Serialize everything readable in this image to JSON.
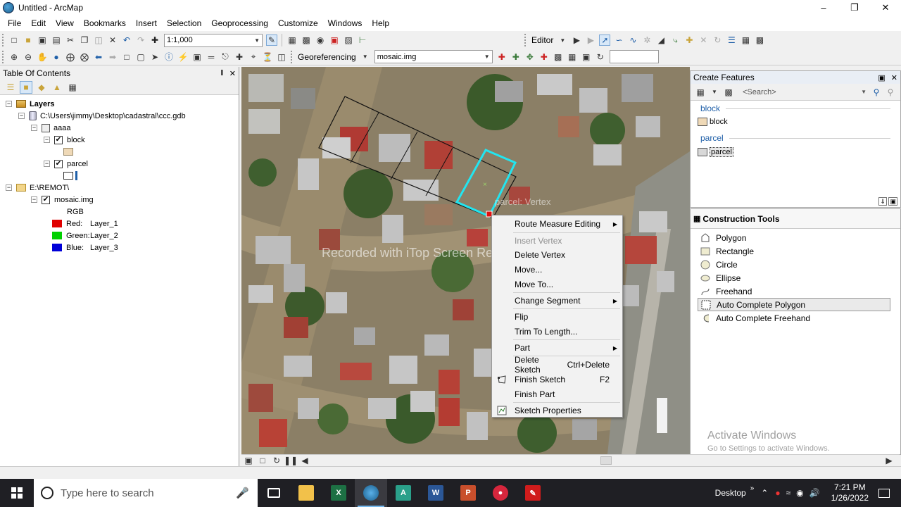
{
  "window": {
    "title": "Untitled - ArcMap",
    "minimize": "–",
    "restore": "❐",
    "close": "✕"
  },
  "menu": [
    "File",
    "Edit",
    "View",
    "Bookmarks",
    "Insert",
    "Selection",
    "Geoprocessing",
    "Customize",
    "Windows",
    "Help"
  ],
  "toolbar": {
    "scale": "1:1,000",
    "editor_label": "Editor",
    "georef_label": "Georeferencing",
    "georef_layer": "mosaic.img"
  },
  "toc": {
    "title": "Table Of Contents",
    "pin": "‖",
    "close": "✕",
    "layers_label": "Layers",
    "gdb_path": "C:\\Users\\jimmy\\Desktop\\cadastral\\ccc.gdb",
    "dataset": "aaaa",
    "block": "block",
    "parcel": "parcel",
    "folder": "E:\\REMOT\\",
    "raster": "mosaic.img",
    "rgb": "RGB",
    "bands": [
      {
        "label": "Red:",
        "layer": "Layer_1",
        "color": "#e00000"
      },
      {
        "label": "Green:",
        "layer": "Layer_2",
        "color": "#00d000"
      },
      {
        "label": "Blue:",
        "layer": "Layer_3",
        "color": "#0000d8"
      }
    ]
  },
  "map": {
    "vertex_tip": "parcel: Vertex",
    "watermark": "Recorded with iTop Screen Recorder",
    "activate_title": "Activate Windows",
    "activate_sub": "Go to Settings to activate Windows."
  },
  "create_features": {
    "title": "Create Features",
    "search_placeholder": "<Search>",
    "groups": [
      {
        "name": "block",
        "template": "block",
        "color": "#efd9b7"
      },
      {
        "name": "parcel",
        "template": "parcel",
        "color": "#d8d8d8"
      }
    ]
  },
  "construction_tools": {
    "title": "Construction Tools",
    "tools": [
      "Polygon",
      "Rectangle",
      "Circle",
      "Ellipse",
      "Freehand",
      "Auto Complete Polygon",
      "Auto Complete Freehand"
    ],
    "selected": "Auto Complete Polygon"
  },
  "context_menu": {
    "route": "Route Measure Editing",
    "insert_vertex": "Insert Vertex",
    "delete_vertex": "Delete Vertex",
    "move": "Move...",
    "move_to": "Move To...",
    "change_segment": "Change Segment",
    "flip": "Flip",
    "trim": "Trim To Length...",
    "part": "Part",
    "delete_sketch": "Delete Sketch",
    "delete_sketch_shortcut": "Ctrl+Delete",
    "finish_sketch": "Finish Sketch",
    "finish_sketch_shortcut": "F2",
    "finish_part": "Finish Part",
    "sketch_properties": "Sketch Properties"
  },
  "taskbar": {
    "search_placeholder": "Type here to search",
    "desktop_label": "Desktop",
    "time": "7:21 PM",
    "date": "1/26/2022"
  }
}
